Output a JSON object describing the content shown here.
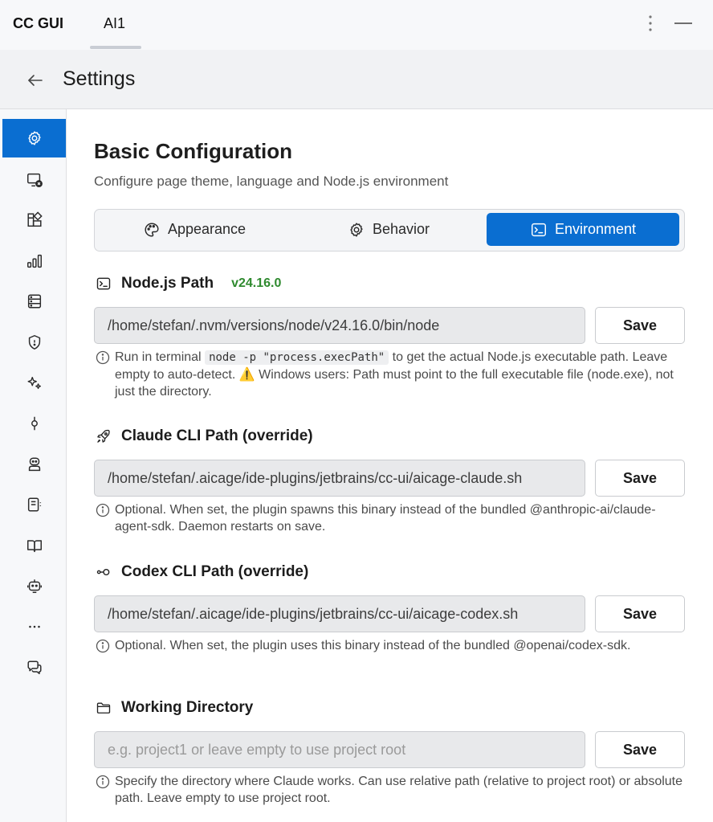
{
  "topbar": {
    "app_title": "CC GUI",
    "active_tab": "AI1",
    "more_icon": "kebab-menu-icon",
    "minimize_icon": "minimize-icon"
  },
  "header": {
    "title": "Settings",
    "back_icon": "arrow-left-icon"
  },
  "sidebar": {
    "items": [
      {
        "icon": "gear-icon",
        "active": true
      },
      {
        "icon": "monitor-icon"
      },
      {
        "icon": "puzzle-icon"
      },
      {
        "icon": "bar-chart-icon"
      },
      {
        "icon": "database-icon"
      },
      {
        "icon": "shield-icon"
      },
      {
        "icon": "sparkles-icon"
      },
      {
        "icon": "git-commit-icon"
      },
      {
        "icon": "agent-icon"
      },
      {
        "icon": "file-list-icon"
      },
      {
        "icon": "book-icon"
      },
      {
        "icon": "bot-icon"
      },
      {
        "icon": "more-horizontal-icon"
      },
      {
        "icon": "chat-icon"
      }
    ]
  },
  "main": {
    "title": "Basic Configuration",
    "subtitle": "Configure page theme, language and Node.js environment",
    "tabs": [
      {
        "label": "Appearance",
        "icon": "palette-icon"
      },
      {
        "label": "Behavior",
        "icon": "gear-icon"
      },
      {
        "label": "Environment",
        "icon": "terminal-icon",
        "active": true
      }
    ],
    "node": {
      "label": "Node.js Path",
      "version": "v24.16.0",
      "value": "/home/stefan/.nvm/versions/node/v24.16.0/bin/node",
      "save": "Save",
      "hint_pre": "Run in terminal",
      "hint_code": "node -p \"process.execPath\"",
      "hint_post": "to get the actual Node.js executable path. Leave empty to auto-detect.",
      "hint_warn_icon": "⚠️",
      "hint_warn": "Windows users: Path must point to the full executable file (node.exe), not just the directory."
    },
    "claude": {
      "label": "Claude CLI Path (override)",
      "value": "/home/stefan/.aicage/ide-plugins/jetbrains/cc-ui/aicage-claude.sh",
      "save": "Save",
      "hint": "Optional. When set, the plugin spawns this binary instead of the bundled @anthropic-ai/claude-agent-sdk. Daemon restarts on save."
    },
    "codex": {
      "label": "Codex CLI Path (override)",
      "value": "/home/stefan/.aicage/ide-plugins/jetbrains/cc-ui/aicage-codex.sh",
      "save": "Save",
      "hint": "Optional. When set, the plugin uses this binary instead of the bundled @openai/codex-sdk."
    },
    "workdir": {
      "label": "Working Directory",
      "placeholder": "e.g. project1 or leave empty to use project root",
      "save": "Save",
      "hint": "Specify the directory where Claude works. Can use relative path (relative to project root) or absolute path. Leave empty to use project root."
    }
  },
  "colors": {
    "accent": "#0a6ed1",
    "version_green": "#2f8a2f"
  }
}
